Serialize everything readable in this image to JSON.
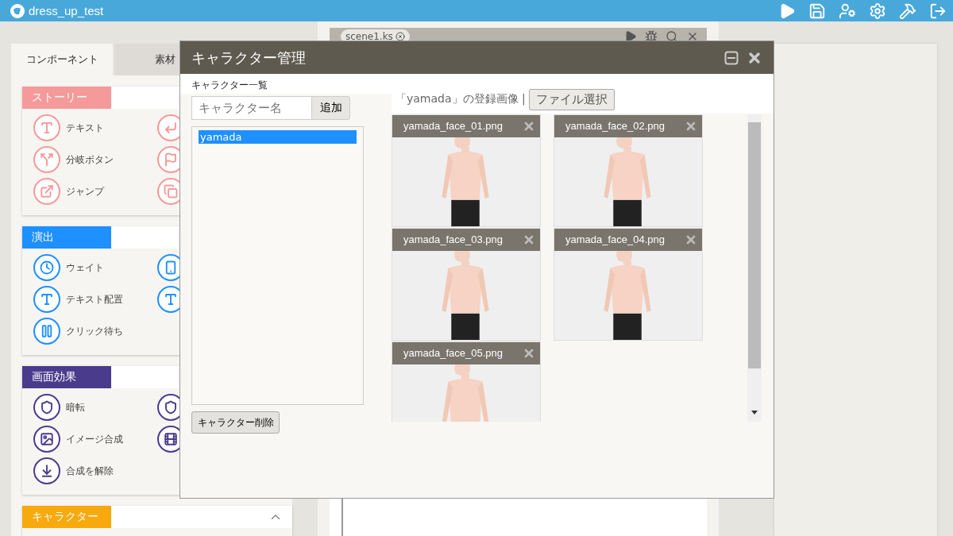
{
  "app": {
    "title": "dress_up_test"
  },
  "side_tabs": [
    {
      "label": "コンポーネント",
      "selected": true
    },
    {
      "label": "素材",
      "selected": false
    }
  ],
  "sections": [
    {
      "title": "ストーリー",
      "color": "#f59a9a",
      "items": [
        "テキスト",
        "分岐ボタン",
        "ジャンプ"
      ]
    },
    {
      "title": "演出",
      "color": "#1e90ff",
      "items": [
        "ウェイト",
        "テキスト配置",
        "クリック待ち"
      ]
    },
    {
      "title": "画面効果",
      "color": "#4b3b8c",
      "items": [
        "暗転",
        "イメージ合成",
        "合成を解除"
      ]
    },
    {
      "title": "キャラクター",
      "color": "#f7a90e"
    }
  ],
  "editor": {
    "tab": "scene1.ks"
  },
  "dialog": {
    "title": "キャラクター管理",
    "list_label": "キャラクター一覧",
    "name_field": {
      "placeholder": "キャラクター名"
    },
    "add_button": "追加",
    "characters": [
      {
        "name": "yamada",
        "selected": true
      }
    ],
    "delete_button": "キャラクター削除",
    "images_label": "「yamada」の登録画像 |",
    "file_button": "ファイル選択",
    "images": [
      {
        "file": "yamada_face_01.png"
      },
      {
        "file": "yamada_face_02.png"
      },
      {
        "file": "yamada_face_03.png"
      },
      {
        "file": "yamada_face_04.png"
      },
      {
        "file": "yamada_face_05.png"
      }
    ]
  }
}
